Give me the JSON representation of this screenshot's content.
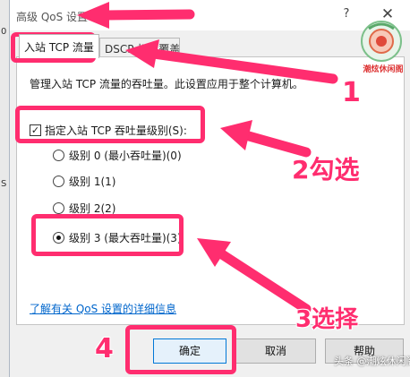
{
  "window": {
    "title": "高级 QoS 设置",
    "help_glyph": "?",
    "close_glyph": "✕"
  },
  "tabs": [
    {
      "label": "入站 TCP 流量"
    },
    {
      "label": "DSCP 标记覆盖"
    }
  ],
  "panel": {
    "description": "管理入站 TCP 流量的吞吐量。此设置应用于整个计算机。",
    "checkbox_label": "指定入站 TCP 吞吐量级别(S):",
    "checkbox_checked": true,
    "radios": [
      {
        "label": "级别 0 (最小吞吐量)(0)",
        "checked": false
      },
      {
        "label": "级别 1(1)",
        "checked": false
      },
      {
        "label": "级别 2(2)",
        "checked": false
      },
      {
        "label": "级别 3 (最大吞吐量)(3)",
        "checked": true
      }
    ],
    "link": "了解有关 QoS 设置的详细信息"
  },
  "buttons": {
    "ok": "确定",
    "cancel": "取消",
    "help": "帮助"
  },
  "annotations": {
    "step1": "1",
    "step2": "2勾选",
    "step3": "3选择",
    "step4": "4",
    "color": "#ff2d6f"
  },
  "left_strip": {
    "stub_top": "0",
    "stub_bottom": "S"
  },
  "watermark": "头条 @潮炫休闲阁",
  "logo_text": "潮炫休闲阁",
  "colors": {
    "accent": "#0078d7",
    "link": "#0066cc",
    "annotation": "#ff2d6f"
  }
}
